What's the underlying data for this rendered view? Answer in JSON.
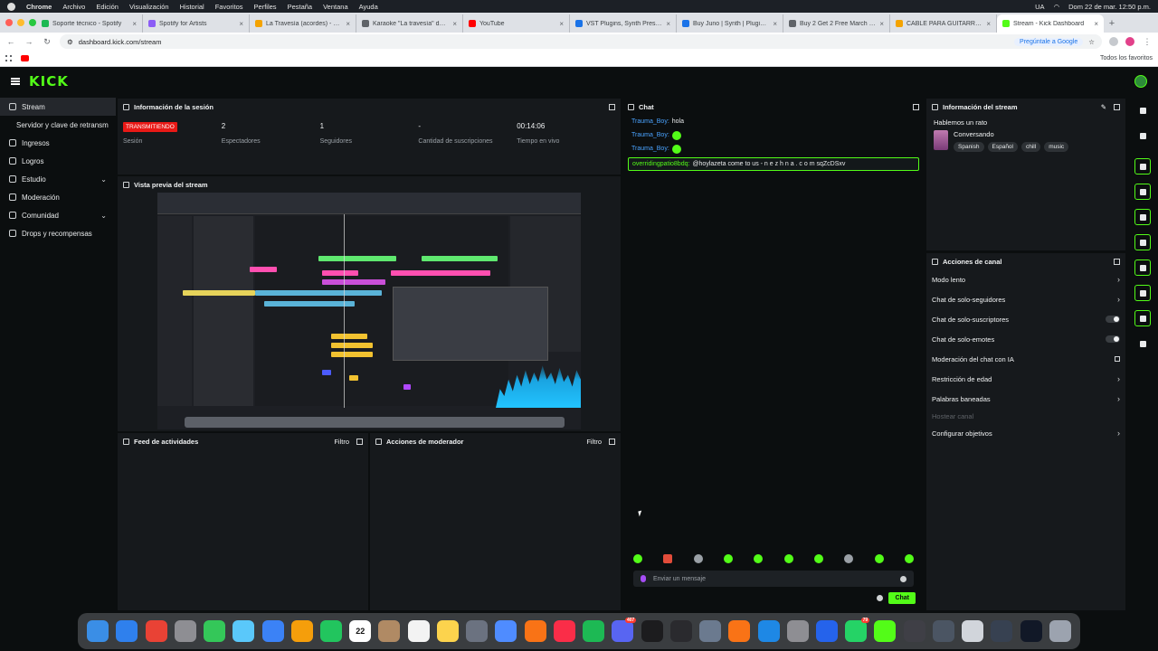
{
  "menubar": {
    "app": "Chrome",
    "items": [
      "Archivo",
      "Edición",
      "Visualización",
      "Historial",
      "Favoritos",
      "Perfiles",
      "Pestaña",
      "Ventana",
      "Ayuda"
    ],
    "right_lang": "UA",
    "clock": "Dom 22 de mar. 12:50 p.m."
  },
  "browser": {
    "tabs": [
      {
        "title": "Soporte técnico - Spotify",
        "color": "#1db954"
      },
      {
        "title": "Spotify for Artists",
        "color": "#8b5cf6"
      },
      {
        "title": "La Travesía (acordes) - Juan",
        "color": "#f4a300"
      },
      {
        "title": "Karaoke \"La travesía\" de Ju",
        "color": "#5f6368"
      },
      {
        "title": "YouTube",
        "color": "#ff0000"
      },
      {
        "title": "VST Plugins, Synth Presets,",
        "color": "#1a73e8"
      },
      {
        "title": "Buy Juno | Synth | Plugin Bo",
        "color": "#1a73e8"
      },
      {
        "title": "Buy 2 Get 2 Free March 202",
        "color": "#5f6368"
      },
      {
        "title": "CABLE PARA GUITARRA - Go",
        "color": "#f4a300"
      },
      {
        "title": "Stream - Kick Dashboard",
        "color": "#53fc18"
      }
    ],
    "url": "dashboard.kick.com/stream",
    "google_btn": "Pregúntale a Google",
    "all_favorites": "Todos los favoritos"
  },
  "kick": {
    "logo": "KICK"
  },
  "sidebar": {
    "items": [
      {
        "label": "Stream",
        "active": true,
        "chevron": ""
      },
      {
        "label": "Servidor y clave de retransm",
        "active": false,
        "chevron": ""
      },
      {
        "label": "Ingresos",
        "active": false,
        "chevron": ""
      },
      {
        "label": "Logros",
        "active": false,
        "chevron": ""
      },
      {
        "label": "Estudio",
        "active": false,
        "chevron": "⌄"
      },
      {
        "label": "Moderación",
        "active": false,
        "chevron": ""
      },
      {
        "label": "Comunidad",
        "active": false,
        "chevron": "⌄"
      },
      {
        "label": "Drops y recompensas",
        "active": false,
        "chevron": ""
      }
    ]
  },
  "session": {
    "title": "Información de la sesión",
    "live_badge": "TRANSMITIENDO",
    "live_label": "Sesión",
    "viewers_value": "2",
    "viewers_label": "Espectadores",
    "followers_value": "1",
    "followers_label": "Seguidores",
    "subs_value": "-",
    "subs_label": "Cantidad de suscripciones",
    "time_value": "00:14:06",
    "time_label": "Tiempo en vivo"
  },
  "preview": {
    "title": "Vista previa del stream"
  },
  "feed": {
    "title": "Feed de actividades",
    "filter": "Filtro"
  },
  "modactions": {
    "title": "Acciones de moderador",
    "filter": "Filtro"
  },
  "chat": {
    "title": "Chat",
    "messages": [
      {
        "user": "Trauma_Boy:",
        "text": "hola",
        "emote": false,
        "highlight": false
      },
      {
        "user": "Trauma_Boy:",
        "text": "",
        "emote": true,
        "highlight": false
      },
      {
        "user": "Trauma_Boy:",
        "text": "",
        "emote": true,
        "highlight": false
      },
      {
        "user": "overridingpatio8bdq:",
        "text": "@hoylazeta come to us - n e z h n a . c o m sqZcDSxv",
        "emote": false,
        "highlight": true
      }
    ],
    "input_placeholder": "Enviar un mensaje",
    "send_label": "Chat"
  },
  "stream_info": {
    "title": "Información del stream",
    "stream_title": "Hablemos un rato",
    "category": "Conversando",
    "tags": [
      "Spanish",
      "Español",
      "chill",
      "music"
    ]
  },
  "channel_actions": {
    "title": "Acciones de canal",
    "items": [
      {
        "label": "Modo lento",
        "control": "chevron"
      },
      {
        "label": "Chat de solo-seguidores",
        "control": "chevron"
      },
      {
        "label": "Chat de solo-suscriptores",
        "control": "toggle"
      },
      {
        "label": "Chat de solo-emotes",
        "control": "toggle"
      },
      {
        "label": "Moderación del chat con IA",
        "control": "external"
      },
      {
        "label": "Restricción de edad",
        "control": "chevron"
      },
      {
        "label": "Palabras baneadas",
        "control": "chevron"
      },
      {
        "label": "Hostear canal",
        "control": "disabled"
      },
      {
        "label": "Configurar objetivos",
        "control": "chevron"
      }
    ]
  },
  "dock": {
    "calendar_day": "22",
    "discord_badge": "407",
    "whatsapp_badge": "79"
  },
  "colors": {
    "kick_green": "#53fc18",
    "live_red": "#e91916",
    "panel_bg": "#16191c",
    "page_bg": "#0b0e0f"
  }
}
